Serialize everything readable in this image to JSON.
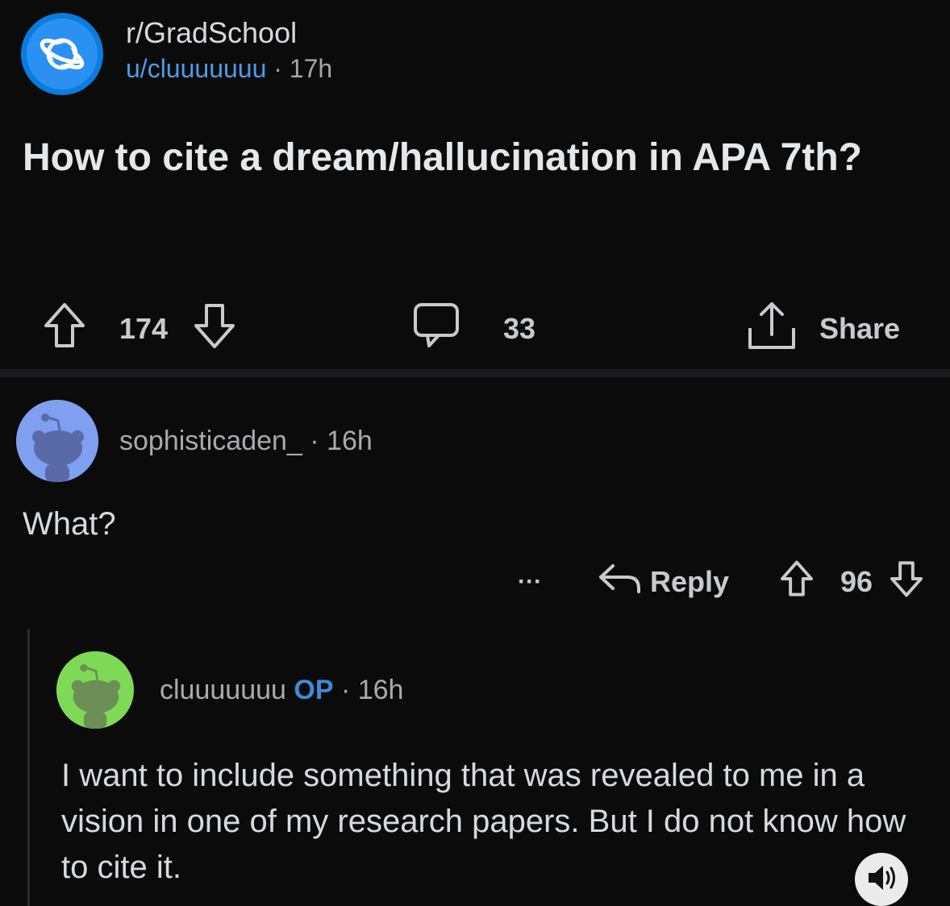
{
  "post": {
    "subreddit": "r/GradSchool",
    "author": "u/cluuuuuuu",
    "separator": " · ",
    "age": "17h",
    "title": "How to cite a dream/hallucination in APA 7th?",
    "upvotes": "174",
    "comments": "33",
    "share_label": "Share"
  },
  "comment1": {
    "user": "sophisticaden_",
    "separator": " · ",
    "age": "16h",
    "body": "What?",
    "more_label": "···",
    "reply_label": "Reply",
    "votes": "96",
    "avatar_color": "#7f9ff0"
  },
  "comment2": {
    "user": "cluuuuuuu",
    "op_label": "OP",
    "separator": " · ",
    "age": "16h",
    "body": "I want to include something that was revealed to me in a vision in one of my research papers. But I do not know how to cite it.",
    "avatar_color": "#7ed957"
  },
  "colors": {
    "background": "#0b0b0c",
    "accent_blue": "#0a7ce0",
    "username_blue": "#4f9be6"
  },
  "icons": {
    "subreddit": "planet-icon",
    "upvote": "arrow-up-icon",
    "downvote": "arrow-down-icon",
    "comment": "speech-bubble-icon",
    "share": "share-icon",
    "reply": "reply-arrow-icon",
    "sound": "speaker-icon"
  }
}
